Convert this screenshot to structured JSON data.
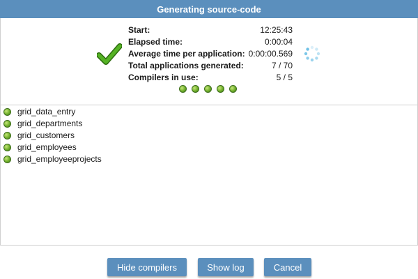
{
  "dialog": {
    "title": "Generating source-code"
  },
  "stats": [
    {
      "label": "Start:",
      "value": "12:25:43"
    },
    {
      "label": "Elapsed time:",
      "value": "0:00:04"
    },
    {
      "label": "Average time per application:",
      "value": "0:00:00.569"
    },
    {
      "label": "Total applications generated:",
      "value": "7 / 70"
    },
    {
      "label": "Compilers in use:",
      "value": "5 / 5"
    }
  ],
  "status": {
    "icon": "checkmark-icon",
    "spinner_icon": "loading-spinner-icon",
    "compiler_indicator_count": 5,
    "accent_color": "#5b8fbd",
    "ok_color": "#4caf1d"
  },
  "log": {
    "items": [
      "grid_data_entry",
      "grid_departments",
      "grid_customers",
      "grid_employees",
      "grid_employeeprojects"
    ]
  },
  "buttons": {
    "hide_compilers": "Hide compilers",
    "show_log": "Show log",
    "cancel": "Cancel"
  }
}
